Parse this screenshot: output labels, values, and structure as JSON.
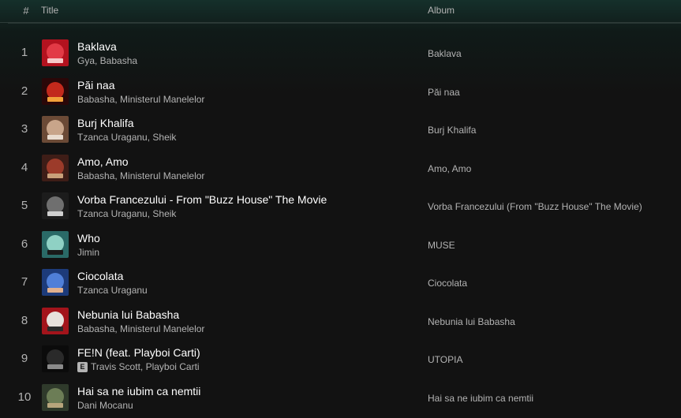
{
  "header": {
    "number_label": "#",
    "title_label": "Title",
    "album_label": "Album"
  },
  "tracks": [
    {
      "number": "1",
      "title": "Baklava",
      "artists": "Gya, Babasha",
      "album": "Baklava",
      "explicit": false,
      "art_colors": [
        "#b3121f",
        "#e23a46",
        "#f6c9c9"
      ]
    },
    {
      "number": "2",
      "title": "Păi naa",
      "artists": "Babasha, Ministerul Manelelor",
      "album": "Păi naa",
      "explicit": false,
      "art_colors": [
        "#2a0708",
        "#c2291c",
        "#f2a13a"
      ]
    },
    {
      "number": "3",
      "title": "Burj Khalifa",
      "artists": "Tzanca Uraganu, Sheik",
      "album": "Burj Khalifa",
      "explicit": false,
      "art_colors": [
        "#6b4a36",
        "#c8a58a",
        "#e9dccf"
      ]
    },
    {
      "number": "4",
      "title": "Amo, Amo",
      "artists": "Babasha, Ministerul Manelelor",
      "album": "Amo, Amo",
      "explicit": false,
      "art_colors": [
        "#3e1d17",
        "#9c3b2a",
        "#c9a07a"
      ]
    },
    {
      "number": "5",
      "title": "Vorba Francezului - From \"Buzz House\" The Movie",
      "artists": "Tzanca Uraganu, Sheik",
      "album": "Vorba Francezului (From \"Buzz House\" The Movie)",
      "explicit": false,
      "art_colors": [
        "#1c1c1c",
        "#6f6f6f",
        "#cfcfcf"
      ]
    },
    {
      "number": "6",
      "title": "Who",
      "artists": "Jimin",
      "album": "MUSE",
      "explicit": false,
      "art_colors": [
        "#2a6a67",
        "#8fd1c4",
        "#1a1a1a"
      ]
    },
    {
      "number": "7",
      "title": "Ciocolata",
      "artists": "Tzanca Uraganu",
      "album": "Ciocolata",
      "explicit": false,
      "art_colors": [
        "#1d3b7a",
        "#4f7fd8",
        "#e0b08e"
      ]
    },
    {
      "number": "8",
      "title": "Nebunia lui Babasha",
      "artists": "Babasha, Ministerul Manelelor",
      "album": "Nebunia lui Babasha",
      "explicit": false,
      "art_colors": [
        "#a3141b",
        "#e7e1dc",
        "#2a2a2a"
      ]
    },
    {
      "number": "9",
      "title": "FE!N (feat. Playboi Carti)",
      "artists": "Travis Scott, Playboi Carti",
      "album": "UTOPIA",
      "explicit": true,
      "explicit_label": "E",
      "art_colors": [
        "#0b0b0b",
        "#2a2a2a",
        "#8a8a8a"
      ]
    },
    {
      "number": "10",
      "title": "Hai sa ne iubim ca nemtii",
      "artists": "Dani Mocanu",
      "album": "Hai sa ne iubim ca nemtii",
      "explicit": false,
      "art_colors": [
        "#2f3a2b",
        "#6c7d56",
        "#b7a57c"
      ]
    }
  ]
}
